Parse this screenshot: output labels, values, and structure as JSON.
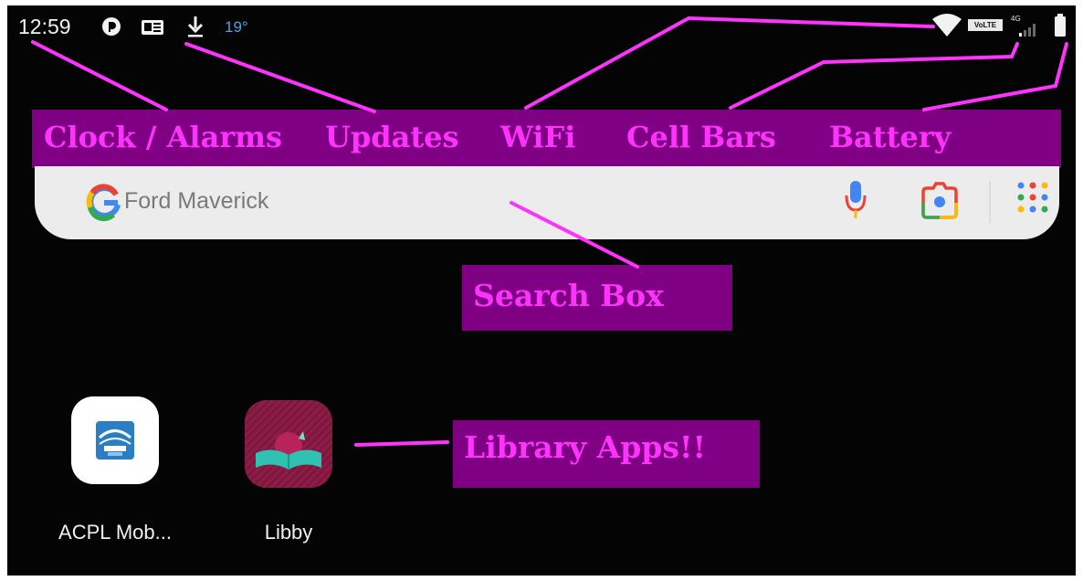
{
  "status_bar": {
    "clock": "12:59",
    "temperature": "19°",
    "volte": "VoLTE",
    "network_type": "4G",
    "icons": [
      "notification-circle-icon",
      "news-card-icon",
      "download-icon",
      "wifi-icon",
      "volte-icon",
      "cell-signal-icon",
      "battery-icon"
    ]
  },
  "annotations": {
    "clock_alarms": "Clock / Alarms",
    "updates": "Updates",
    "wifi": "WiFi",
    "cell_bars": "Cell Bars",
    "battery": "Battery",
    "search_box": "Search Box",
    "library_apps": "Library Apps!!"
  },
  "search": {
    "placeholder": "Ford Maverick",
    "icons": [
      "google-g-icon",
      "microphone-icon",
      "camera-lens-icon",
      "app-grid-icon"
    ]
  },
  "apps": [
    {
      "label": "ACPL Mob...",
      "icon": "acpl-app-icon"
    },
    {
      "label": "Libby",
      "icon": "libby-app-icon"
    }
  ],
  "colors": {
    "annotation_bg": "#7f0082",
    "annotation_text": "#ff33ff",
    "pointer_line": "#ff33ff",
    "background": "#040404"
  }
}
